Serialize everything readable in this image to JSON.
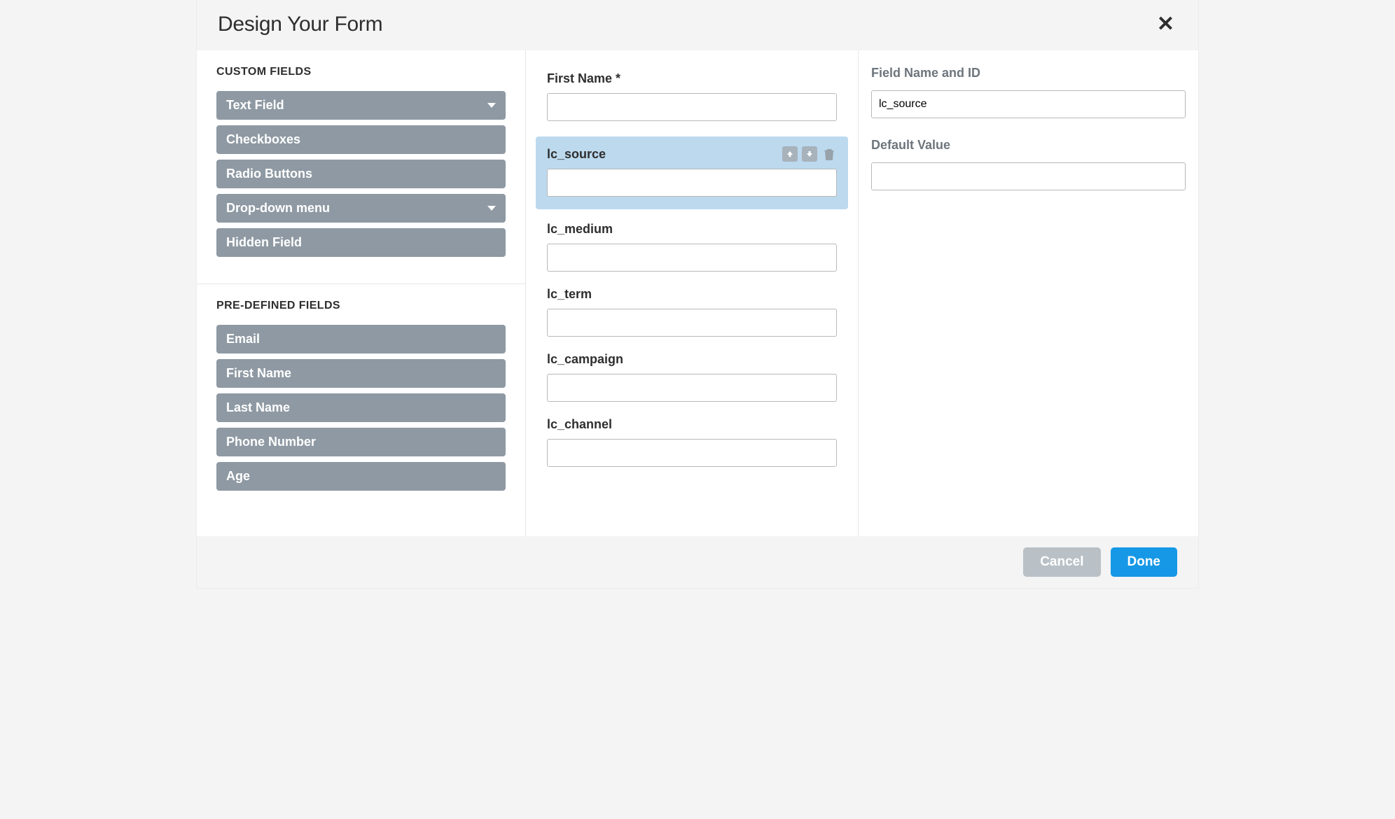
{
  "header": {
    "title": "Design Your Form"
  },
  "sidebar": {
    "custom_title": "CUSTOM FIELDS",
    "custom_fields": [
      {
        "label": "Text Field",
        "has_caret": true
      },
      {
        "label": "Checkboxes",
        "has_caret": false
      },
      {
        "label": "Radio Buttons",
        "has_caret": false
      },
      {
        "label": "Drop-down menu",
        "has_caret": true
      },
      {
        "label": "Hidden Field",
        "has_caret": false
      }
    ],
    "predefined_title": "PRE-DEFINED FIELDS",
    "predefined_fields": [
      {
        "label": "Email"
      },
      {
        "label": "First Name"
      },
      {
        "label": "Last Name"
      },
      {
        "label": "Phone Number"
      },
      {
        "label": "Age"
      }
    ]
  },
  "form": {
    "fields": [
      {
        "label": "First Name *",
        "selected": false
      },
      {
        "label": "lc_source",
        "selected": true
      },
      {
        "label": "lc_medium",
        "selected": false
      },
      {
        "label": "lc_term",
        "selected": false
      },
      {
        "label": "lc_campaign",
        "selected": false
      },
      {
        "label": "lc_channel",
        "selected": false
      }
    ]
  },
  "properties": {
    "name_label": "Field Name and ID",
    "name_value": "lc_source",
    "default_label": "Default Value",
    "default_value": ""
  },
  "footer": {
    "cancel": "Cancel",
    "done": "Done"
  }
}
